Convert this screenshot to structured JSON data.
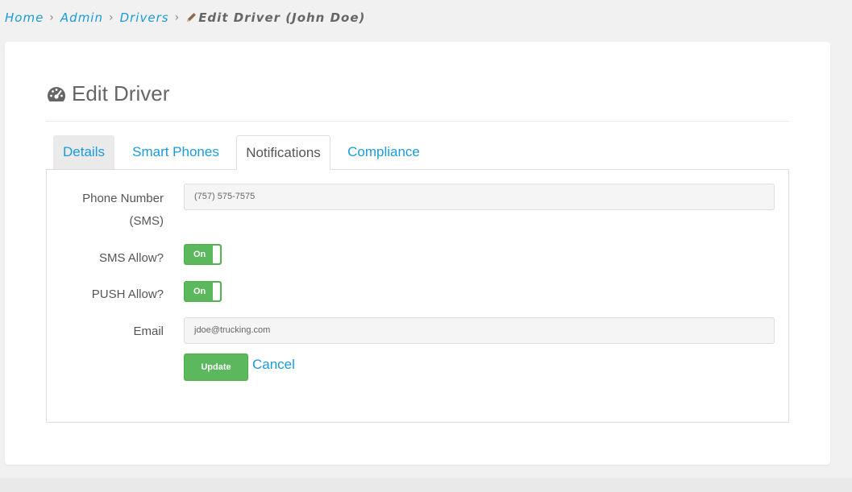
{
  "breadcrumb": {
    "items": [
      "Home",
      "Admin",
      "Drivers"
    ],
    "separator": "›",
    "current": "Edit Driver (John Doe)",
    "current_icon": "pencil-icon"
  },
  "page": {
    "title": "Edit Driver",
    "title_icon": "dashboard-icon"
  },
  "tabs": [
    {
      "label": "Details"
    },
    {
      "label": "Smart Phones"
    },
    {
      "label": "Notifications",
      "active": true
    },
    {
      "label": "Compliance"
    }
  ],
  "form": {
    "phone_label_line1": "Phone Number",
    "phone_label_line2": "(SMS)",
    "phone_value": "(757) 575-7575",
    "sms_label": "SMS Allow?",
    "sms_toggle": "On",
    "push_label": "PUSH Allow?",
    "push_toggle": "On",
    "email_label": "Email",
    "email_value": "jdoe@trucking.com",
    "update_label": "Update",
    "cancel_label": "Cancel"
  },
  "colors": {
    "link": "#1a9bd7",
    "success": "#5cb85c",
    "background": "#f1f1f1"
  }
}
